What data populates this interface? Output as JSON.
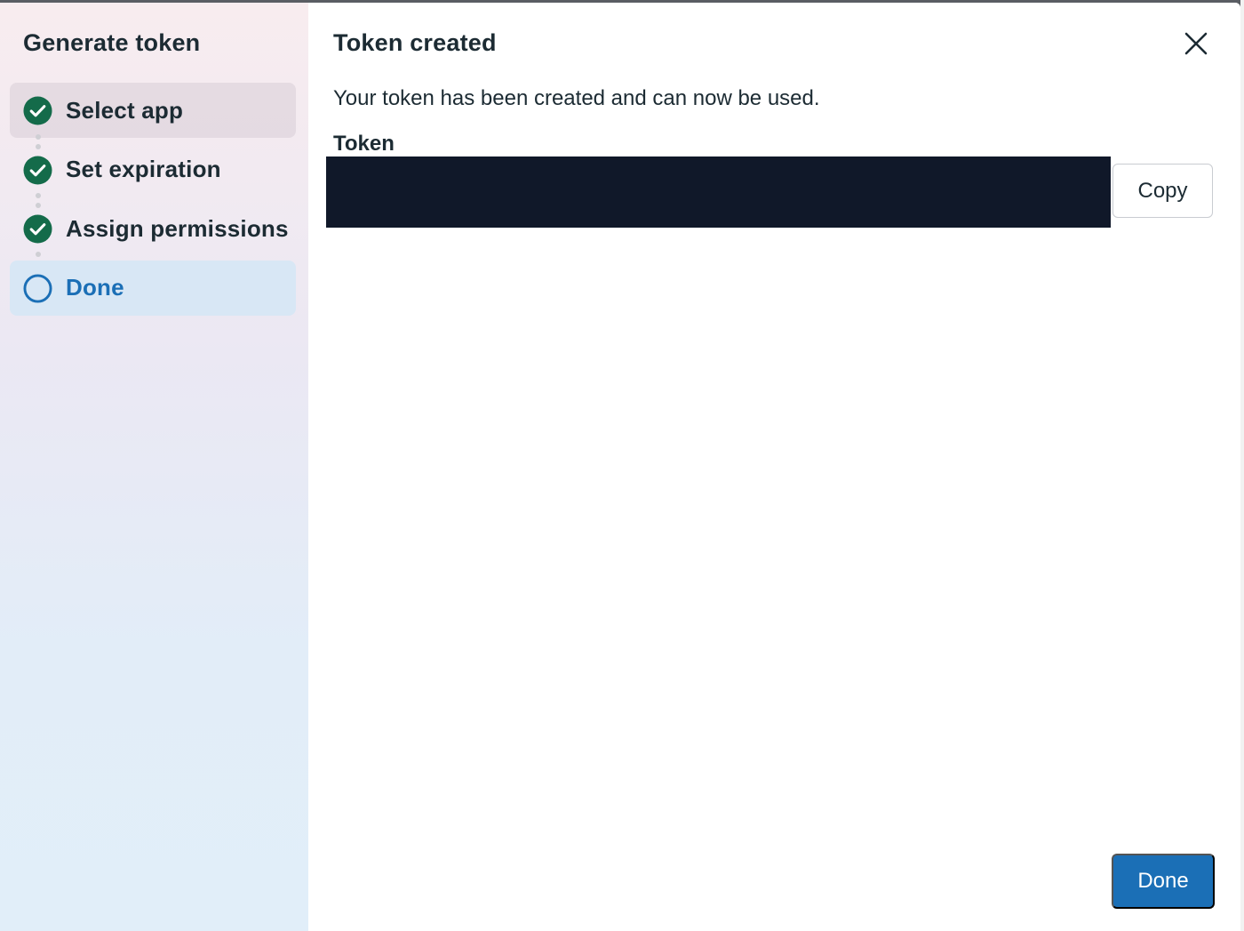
{
  "sidebar": {
    "title": "Generate token",
    "steps": [
      {
        "label": "Select app",
        "status": "completed",
        "icon": "check-circle-icon"
      },
      {
        "label": "Set expiration",
        "status": "completed",
        "icon": "check-circle-icon"
      },
      {
        "label": "Assign permissions",
        "status": "completed",
        "icon": "check-circle-icon"
      },
      {
        "label": "Done",
        "status": "current",
        "icon": "empty-circle-icon"
      }
    ]
  },
  "main": {
    "title": "Token created",
    "description": "Your token has been created and can now be used.",
    "token_label": "Token",
    "token_value": "",
    "copy_label": "Copy",
    "done_label": "Done",
    "close_icon": "close-icon"
  },
  "colors": {
    "check_green": "#146b4a",
    "accent_blue": "#1b6fb6",
    "token_redaction": "#101829",
    "text_primary": "#1c2b33"
  }
}
